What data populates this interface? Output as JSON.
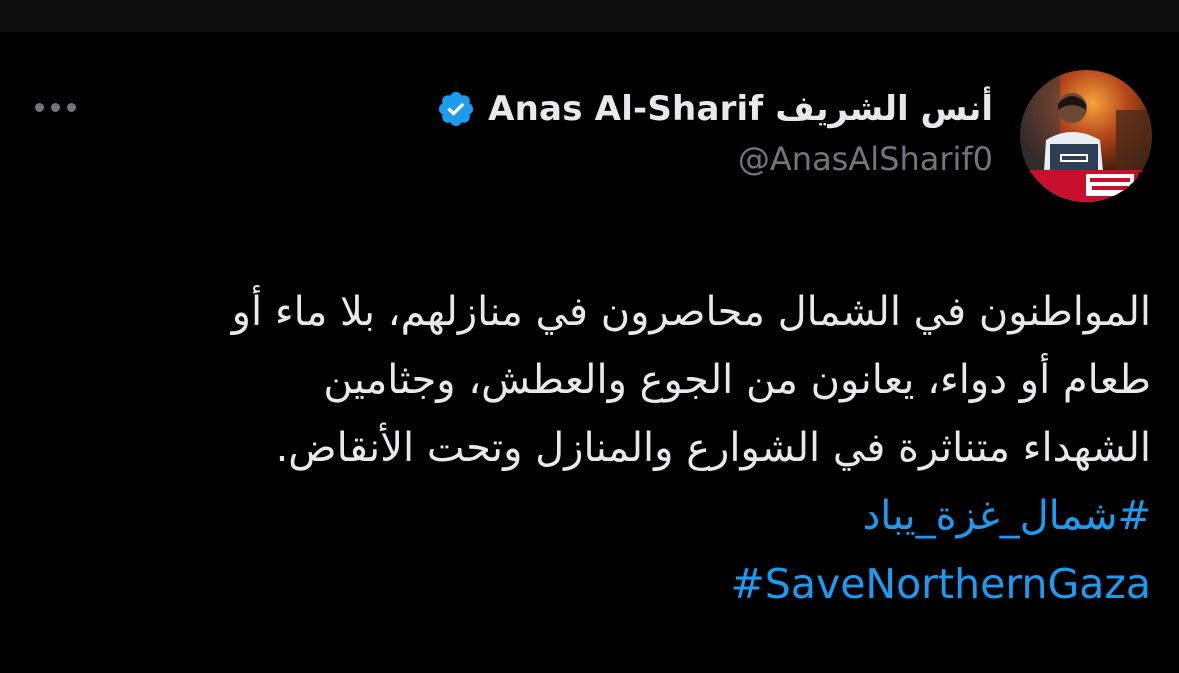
{
  "author": {
    "display_name": "أنس الشريف Anas Al-Sharif",
    "handle": "@AnasAlSharif0",
    "verified_icon": "verified-badge-icon",
    "avatar_icon": "avatar-photo"
  },
  "menu": {
    "more_icon": "more-horizontal-icon"
  },
  "tweet": {
    "text": "المواطنون في الشمال محاصرون في منازلهم، بلا ماء أو\nطعام أو دواء، يعانون من الجوع والعطش، وجثامين\nالشهداء متناثرة في الشوارع والمنازل وتحت الأنقاض.",
    "hashtags": [
      "#شمال_غزة_يباد",
      "#SaveNorthernGaza"
    ]
  },
  "colors": {
    "background": "#000000",
    "text": "#e7e9ea",
    "secondary_text": "#71767b",
    "link": "#1d9bf0",
    "verified": "#1d9bf0"
  }
}
